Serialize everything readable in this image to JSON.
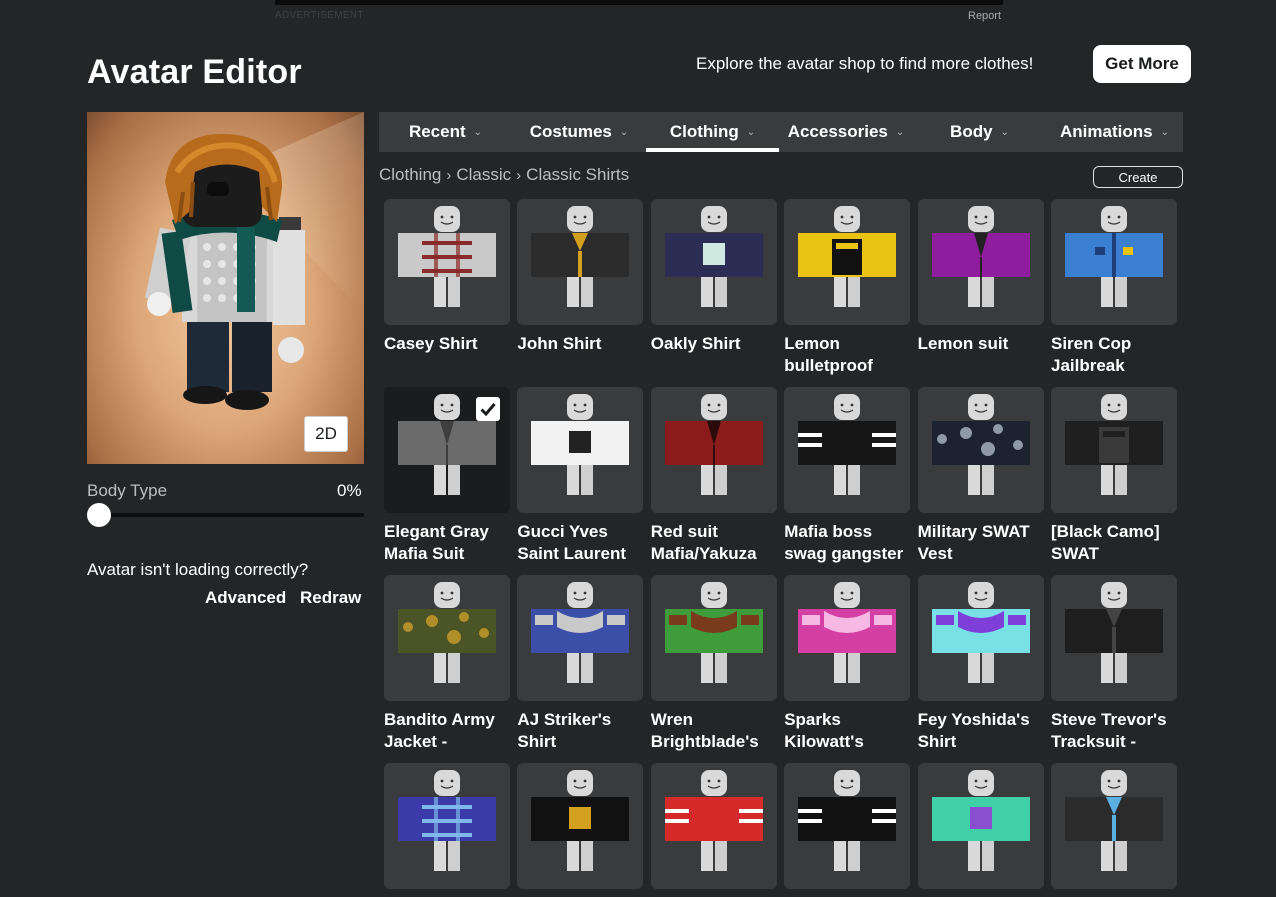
{
  "ad": {
    "label": "ADVERTISEMENT",
    "report": "Report"
  },
  "header": {
    "title": "Avatar Editor",
    "explore_text": "Explore the avatar shop to find more clothes!",
    "get_more_label": "Get More"
  },
  "preview": {
    "toggle_label": "2D"
  },
  "body_type": {
    "label": "Body Type",
    "value": "0%",
    "level": 0
  },
  "help": {
    "text": "Avatar isn't loading correctly?",
    "advanced": "Advanced",
    "redraw": "Redraw"
  },
  "tabs": [
    {
      "label": "Recent",
      "active": false
    },
    {
      "label": "Costumes",
      "active": false
    },
    {
      "label": "Clothing",
      "active": true
    },
    {
      "label": "Accessories",
      "active": false
    },
    {
      "label": "Body",
      "active": false
    },
    {
      "label": "Animations",
      "active": false
    }
  ],
  "breadcrumb": [
    "Clothing",
    "Classic",
    "Classic Shirts"
  ],
  "create_label": "Create",
  "colors": {
    "background": "#232527",
    "panel": "#393b3d"
  },
  "items": [
    {
      "name": [
        "Casey Shirt"
      ],
      "torso": "#c9c9c9",
      "accent": "#8b2a2a",
      "pattern": "plaid"
    },
    {
      "name": [
        "John Shirt"
      ],
      "torso": "#2b2b2b",
      "accent": "#d4a020",
      "pattern": "jacket"
    },
    {
      "name": [
        "Oakly Shirt"
      ],
      "torso": "#2b2d55",
      "accent": "#cfe9e0",
      "pattern": "print"
    },
    {
      "name": [
        "Lemon",
        "bulletproof"
      ],
      "torso": "#e9c212",
      "accent": "#111111",
      "pattern": "vest"
    },
    {
      "name": [
        "Lemon suit"
      ],
      "torso": "#8e1e9e",
      "accent": "#222222",
      "pattern": "suit"
    },
    {
      "name": [
        "Siren Cop",
        "Jailbreak"
      ],
      "torso": "#3a7fd0",
      "accent": "#1f3f7a",
      "pattern": "cop"
    },
    {
      "name": [
        "Elegant Gray",
        "Mafia Suit"
      ],
      "torso": "#6b6b6b",
      "accent": "#3e3e3e",
      "pattern": "suit",
      "selected": true
    },
    {
      "name": [
        "Gucci Yves",
        "Saint Laurent"
      ],
      "torso": "#f2f2f2",
      "accent": "#222222",
      "pattern": "print"
    },
    {
      "name": [
        "Red suit",
        "Mafia/Yakuza"
      ],
      "torso": "#8c1c1c",
      "accent": "#2a0a0a",
      "pattern": "suit"
    },
    {
      "name": [
        "Mafia boss",
        "swag gangster"
      ],
      "torso": "#161616",
      "accent": "#ffffff",
      "pattern": "stripes"
    },
    {
      "name": [
        "Military SWAT",
        "Vest"
      ],
      "torso": "#1d2230",
      "accent": "#8f99a8",
      "pattern": "camo"
    },
    {
      "name": [
        "[Black Camo]",
        "SWAT"
      ],
      "torso": "#1f1f1f",
      "accent": "#3a3a3a",
      "pattern": "vest"
    },
    {
      "name": [
        "Bandito Army",
        "Jacket -"
      ],
      "torso": "#4a5426",
      "accent": "#b08f2a",
      "pattern": "camo"
    },
    {
      "name": [
        "AJ Striker's",
        "Shirt"
      ],
      "torso": "#3c4fa8",
      "accent": "#c9c9c9",
      "pattern": "armor"
    },
    {
      "name": [
        "Wren",
        "Brightblade's"
      ],
      "torso": "#3f9c3a",
      "accent": "#7a3b1c",
      "pattern": "armor"
    },
    {
      "name": [
        "Sparks",
        "Kilowatt's"
      ],
      "torso": "#d43fa3",
      "accent": "#f7b8e4",
      "pattern": "armor"
    },
    {
      "name": [
        "Fey Yoshida's",
        "Shirt"
      ],
      "torso": "#79e0e6",
      "accent": "#7d3fd8",
      "pattern": "armor"
    },
    {
      "name": [
        "Steve Trevor's",
        "Tracksuit -"
      ],
      "torso": "#1e1e1e",
      "accent": "#444444",
      "pattern": "jacket"
    },
    {
      "name": [
        ""
      ],
      "torso": "#3b3aa8",
      "accent": "#7fb7e8",
      "pattern": "plaid"
    },
    {
      "name": [
        ""
      ],
      "torso": "#111111",
      "accent": "#d4a020",
      "pattern": "print"
    },
    {
      "name": [
        ""
      ],
      "torso": "#d62a2a",
      "accent": "#ffffff",
      "pattern": "stripes"
    },
    {
      "name": [
        ""
      ],
      "torso": "#111111",
      "accent": "#ffffff",
      "pattern": "stripes"
    },
    {
      "name": [
        ""
      ],
      "torso": "#3fd0a8",
      "accent": "#8a4fd0",
      "pattern": "print"
    },
    {
      "name": [
        ""
      ],
      "torso": "#2b2b2b",
      "accent": "#5ab0e0",
      "pattern": "jacket"
    }
  ]
}
